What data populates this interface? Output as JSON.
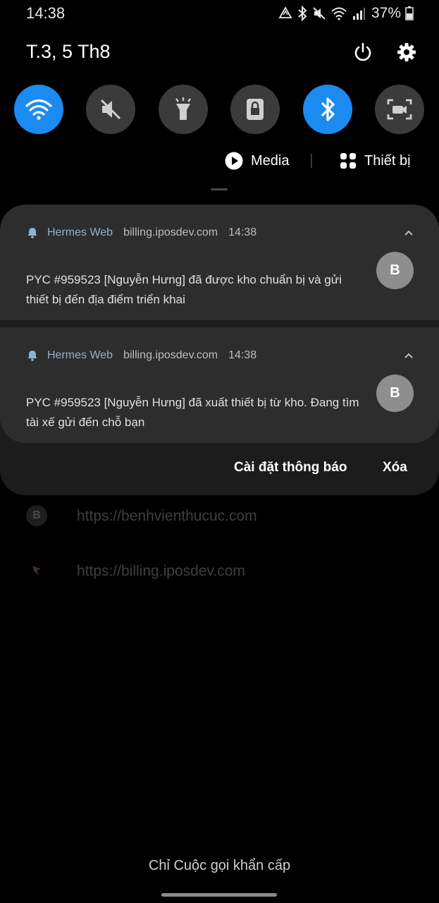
{
  "status_bar": {
    "time": "14:38",
    "battery": "37%",
    "icons": [
      "sync-icon",
      "bluetooth-icon",
      "mute-icon",
      "wifi-icon",
      "signal-icon",
      "battery-icon"
    ]
  },
  "quick_panel": {
    "date": "T.3, 5 Th8",
    "tiles": [
      {
        "icon": "wifi-icon",
        "state": "on"
      },
      {
        "icon": "sound-off-icon",
        "state": "off"
      },
      {
        "icon": "flashlight-icon",
        "state": "off"
      },
      {
        "icon": "lock-icon",
        "state": "off"
      },
      {
        "icon": "bluetooth-icon",
        "state": "on"
      },
      {
        "icon": "screen-capture-icon",
        "state": "off"
      }
    ],
    "media_label": "Media",
    "devices_label": "Thiết bị",
    "accent_color": "#1b8bf2"
  },
  "notifications": [
    {
      "app": "Hermes Web",
      "source": "billing.iposdev.com",
      "time": "14:38",
      "body": "PYC #959523 [Nguyễn Hưng]  đã được kho chuẩn bị và gửi thiết bị đến địa điểm triển khai",
      "avatar_letter": "B"
    },
    {
      "app": "Hermes Web",
      "source": "billing.iposdev.com",
      "time": "14:38",
      "body": "PYC #959523 [Nguyễn Hưng]  đã xuất thiết bị từ kho. Đang tìm tài xế gửi đến chỗ bạn",
      "avatar_letter": "B"
    }
  ],
  "notification_actions": {
    "settings_label": "Cài đặt thông báo",
    "clear_label": "Xóa"
  },
  "background_items": [
    {
      "icon_letter": "B",
      "url": "https://benhvienthucuc.com"
    },
    {
      "url": "https://billing.iposdev.com"
    }
  ],
  "emergency_label": "Chỉ Cuộc gọi khẩn cấp"
}
